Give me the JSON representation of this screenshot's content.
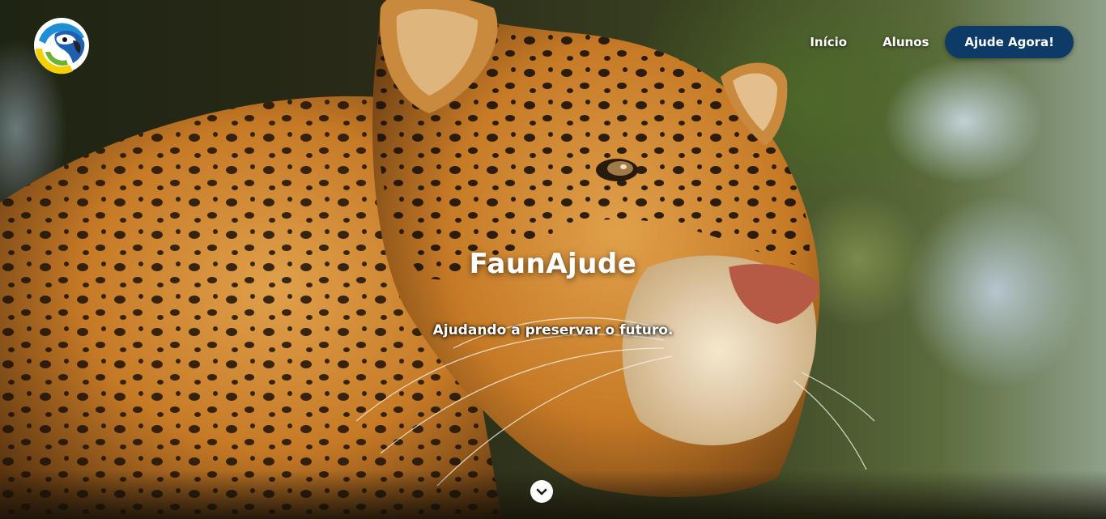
{
  "brand": {
    "logo_icon": "macaw-parrot-logo-icon",
    "colors": {
      "logo_ring_blue": "#1e8fd6",
      "logo_yellow": "#f5d000",
      "logo_green": "#6ab42e"
    }
  },
  "nav": {
    "items": [
      {
        "label": "Início"
      },
      {
        "label": "Alunos"
      }
    ],
    "cta_label": "Ajude Agora!",
    "cta_color": "#0d3a66"
  },
  "hero": {
    "title": "FaunAjude",
    "subtitle": "Ajudando a preservar o futuro.",
    "background_subject": "jaguar-photo",
    "scroll_icon": "chevron-down-icon"
  }
}
